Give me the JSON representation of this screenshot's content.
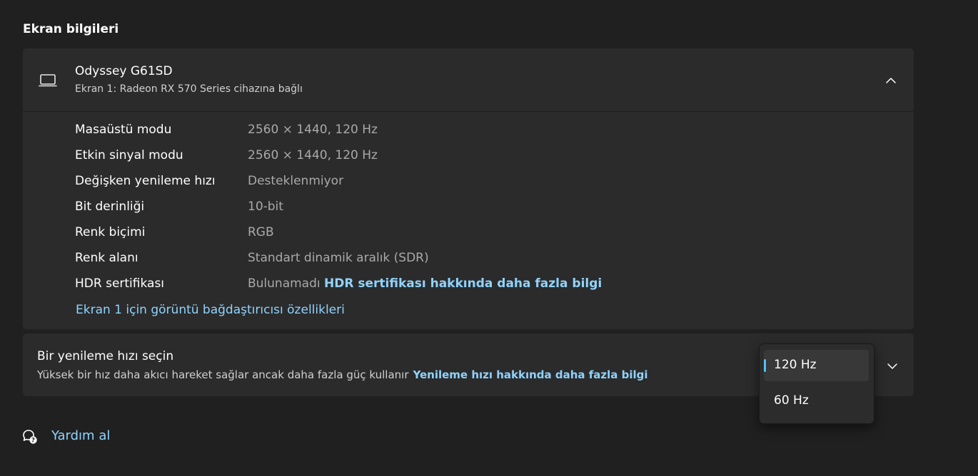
{
  "section_title": "Ekran bilgileri",
  "display": {
    "name": "Odyssey G61SD",
    "subtitle": "Ekran 1: Radeon RX 570 Series cihazına bağlı",
    "rows": [
      {
        "label": "Masaüstü modu",
        "value": "2560 × 1440, 120 Hz"
      },
      {
        "label": "Etkin sinyal modu",
        "value": "2560 × 1440, 120 Hz"
      },
      {
        "label": "Değişken yenileme hızı",
        "value": "Desteklenmiyor"
      },
      {
        "label": "Bit derinliği",
        "value": "10-bit"
      },
      {
        "label": "Renk biçimi",
        "value": "RGB"
      },
      {
        "label": "Renk alanı",
        "value": "Standart dinamik aralık (SDR)"
      },
      {
        "label": "HDR sertifikası",
        "value": "Bulunamadı",
        "link": "HDR sertifikası hakkında daha fazla bilgi"
      }
    ],
    "adapter_link": "Ekran 1 için görüntü bağdaştırıcısı özellikleri"
  },
  "refresh": {
    "title": "Bir yenileme hızı seçin",
    "subtitle": "Yüksek bir hız daha akıcı hareket sağlar ancak daha fazla güç kullanır",
    "link": "Yenileme hızı hakkında daha fazla bilgi",
    "options": [
      "120 Hz",
      "60 Hz"
    ],
    "selected": "120 Hz"
  },
  "help": {
    "label": "Yardım al"
  },
  "colors": {
    "accent": "#4cc2ff",
    "link": "#8fd3fe",
    "background": "#202020",
    "card": "#2b2b2b"
  },
  "icons": {
    "monitor": "monitor-icon",
    "collapse": "chevron-up-icon",
    "expand": "chevron-down-icon",
    "help": "help-chat-icon"
  }
}
